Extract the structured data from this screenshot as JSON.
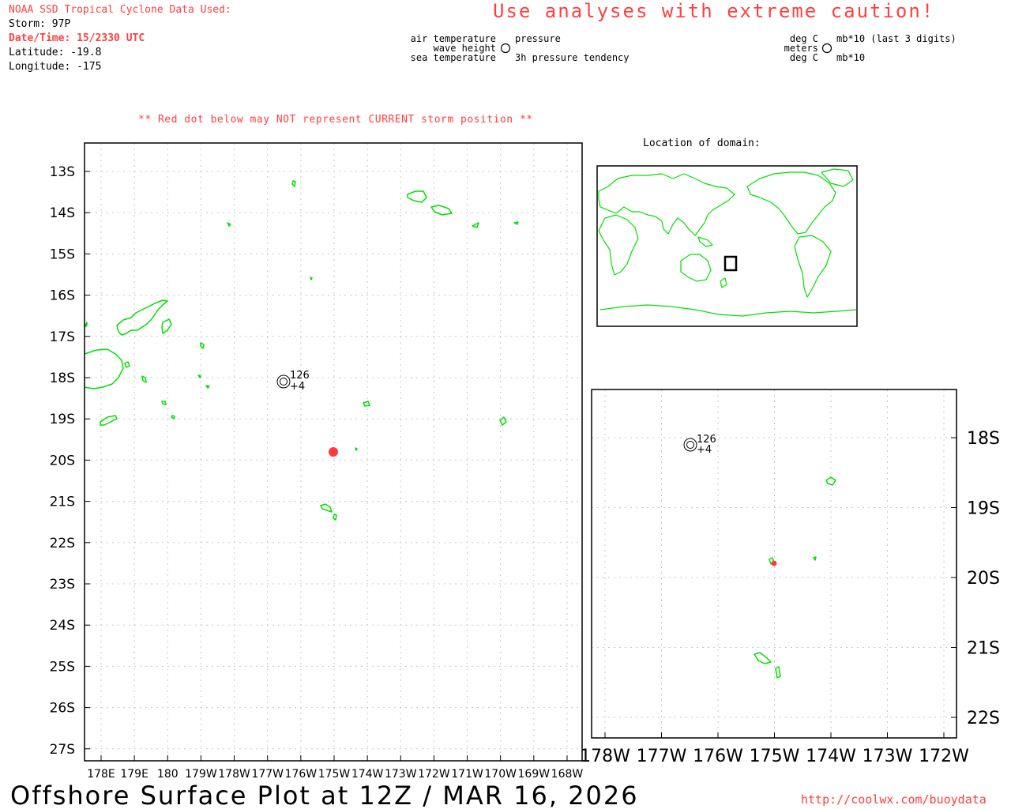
{
  "header": {
    "source": "NOAA SSD Tropical Cyclone Data Used:",
    "storm": "Storm: 97P",
    "datetime": "Date/Time: 15/2330 UTC",
    "latitude": "Latitude: -19.8",
    "longitude": "Longitude: -175"
  },
  "caution": "Use analyses with extreme caution!",
  "legend": {
    "left_tl": "air temperature",
    "left_ml": "wave height",
    "left_bl": "sea temperature",
    "left_tr": "pressure",
    "left_br": "3h pressure tendency",
    "right_tl": "deg C",
    "right_ml": "meters",
    "right_bl": "deg C",
    "right_tr": "mb*10 (last 3 digits)",
    "right_br": "mb*10"
  },
  "warning": "** Red dot below may NOT represent CURRENT storm position **",
  "inset_title": "Location of domain:",
  "main_map": {
    "lat_labels": [
      "13S",
      "14S",
      "15S",
      "16S",
      "17S",
      "18S",
      "19S",
      "20S",
      "21S",
      "22S",
      "23S",
      "24S",
      "25S",
      "26S",
      "27S"
    ],
    "lon_labels": [
      "178E",
      "179E",
      "180",
      "179W",
      "178W",
      "177W",
      "176W",
      "175W",
      "174W",
      "173W",
      "172W",
      "171W",
      "170W",
      "169W",
      "168W"
    ],
    "station": {
      "pressure": "126",
      "tendency": "+4",
      "lat": -18.1,
      "lon": -176.5
    },
    "storm": {
      "lat": -19.8,
      "lon": -175
    }
  },
  "zoom_map": {
    "lat_labels": [
      "18S",
      "19S",
      "20S",
      "21S",
      "22S"
    ],
    "lon_labels": [
      "178W",
      "177W",
      "176W",
      "175W",
      "174W",
      "173W",
      "172W"
    ],
    "station": {
      "pressure": "126",
      "tendency": "+4"
    }
  },
  "footer": {
    "title": "Offshore Surface Plot at 12Z / MAR 16, 2026",
    "url": "http://coolwx.com/buoydata"
  },
  "colors": {
    "land": "#00e000",
    "storm_dot": "#ff3b3b",
    "text_red": "#ff4040",
    "grid": "#c8c8c8"
  }
}
